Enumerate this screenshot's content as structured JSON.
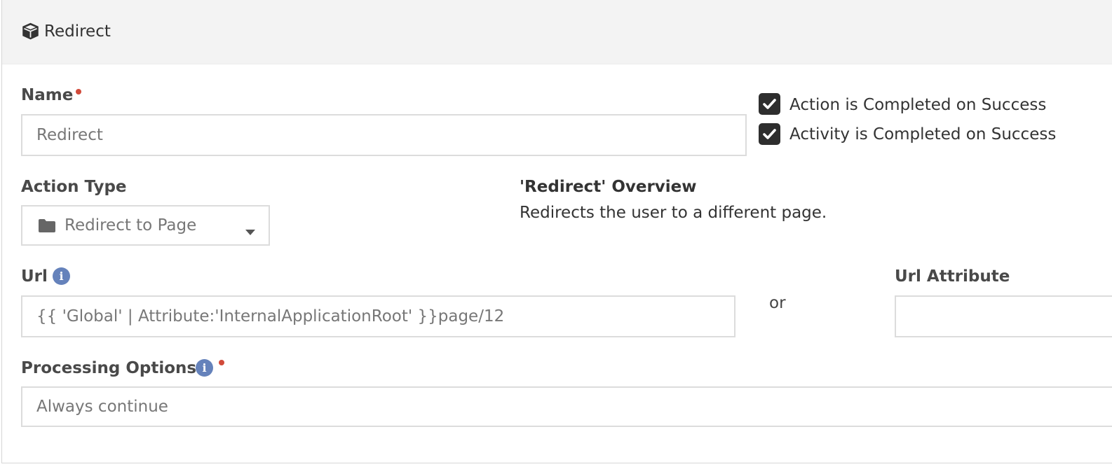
{
  "panel": {
    "title": "Redirect",
    "title_icon": "cube-icon"
  },
  "name_field": {
    "label": "Name",
    "required": true,
    "value": "Redirect"
  },
  "checkboxes": [
    {
      "label": "Action is Completed on Success",
      "checked": true
    },
    {
      "label": "Activity is Completed on Success",
      "checked": true
    }
  ],
  "action_type": {
    "label": "Action Type",
    "selected": "Redirect to Page",
    "icon": "folder-icon"
  },
  "overview": {
    "title": "'Redirect' Overview",
    "description": "Redirects the user to a different page."
  },
  "url_field": {
    "label": "Url",
    "value": "{{ 'Global' | Attribute:'InternalApplicationRoot' }}page/12",
    "icon": "info-icon"
  },
  "separator_text": "or",
  "url_attribute": {
    "label": "Url Attribute",
    "value": ""
  },
  "processing_options": {
    "label": "Processing Options",
    "required": true,
    "value": "Always continue",
    "icon": "info-icon"
  },
  "colors": {
    "panel_heading_bg": "#f3f3f3",
    "required_dot": "#d14a3a",
    "info_icon": "#6582bb",
    "checkbox_bg": "#2e2e2e"
  }
}
